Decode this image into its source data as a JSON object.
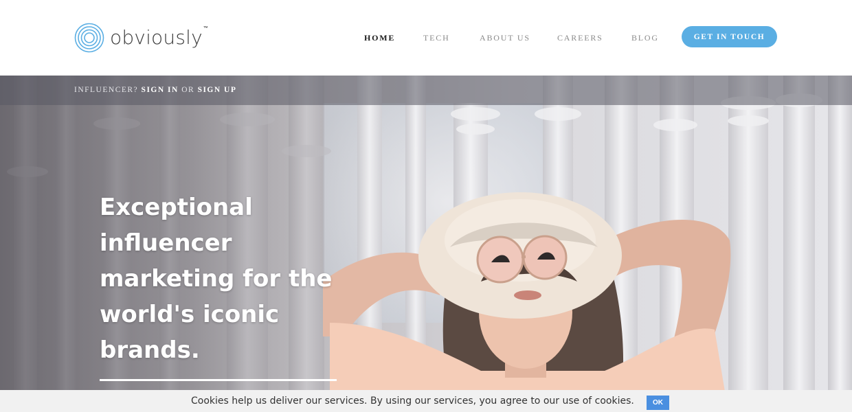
{
  "header": {
    "logo": {
      "text": "obviously",
      "trademark": "™"
    },
    "nav": [
      {
        "label": "HOME",
        "active": true
      },
      {
        "label": "TECH",
        "active": false
      },
      {
        "label": "ABOUT US",
        "active": false
      },
      {
        "label": "CAREERS",
        "active": false
      },
      {
        "label": "BLOG",
        "active": false
      }
    ],
    "cta_label": "GET IN TOUCH"
  },
  "signin_bar": {
    "prefix": "INFLUENCER?",
    "sign_in": "SIGN IN",
    "or": "OR",
    "sign_up": "SIGN UP"
  },
  "hero": {
    "headline": "Exceptional influencer marketing for the world's iconic brands."
  },
  "cookie_bar": {
    "message": "Cookies help us deliver our services. By using our services, you agree to our use of cookies.",
    "ok_label": "OK"
  },
  "colors": {
    "accent": "#5aaee3",
    "cookie_button": "#4a8fe0",
    "nav_active": "#1a1a1a",
    "nav_inactive": "#8a8a8a"
  },
  "icons": {
    "logo_mark": "concentric-circles-icon"
  }
}
